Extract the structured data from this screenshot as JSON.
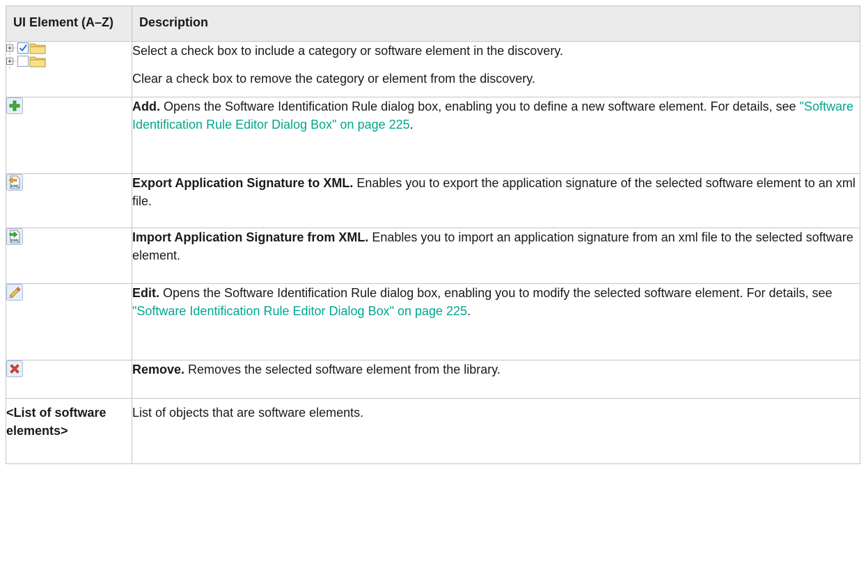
{
  "header": {
    "col1": "UI Element (A–Z)",
    "col2": "Description"
  },
  "rows": {
    "tree": {
      "icon": "tree-checkbox-folder-icons",
      "line1": "Select a check box to include a category or software element in the discovery.",
      "line2": "Clear a check box to remove the category or element from the discovery."
    },
    "add": {
      "icon": "add-icon",
      "title": "Add.",
      "text": " Opens the Software Identification Rule dialog box, enabling you to define a new software element. For details, see ",
      "link": "\"Software Identification Rule Editor Dialog Box\" on page 225",
      "after": "."
    },
    "export": {
      "icon": "export-xml-icon",
      "title": "Export Application Signature to XML.",
      "text": " Enables you to export the application signature of the selected software element to an xml file."
    },
    "import": {
      "icon": "import-xml-icon",
      "title": "Import Application Signature from XML.",
      "text": " Enables you to import an application signature from an xml file to the selected software element."
    },
    "edit": {
      "icon": "edit-pencil-icon",
      "title": "Edit.",
      "text": " Opens the Software Identification Rule dialog box, enabling you to modify the selected software element. For details, see ",
      "link": "\"Software Identification Rule Editor Dialog Box\" on page 225",
      "after": "."
    },
    "remove": {
      "icon": "remove-x-icon",
      "title": "Remove.",
      "text": " Removes the selected software element from the library."
    },
    "list": {
      "element": "<List of software elements>",
      "text": "List of objects that are software elements."
    }
  },
  "colors": {
    "link": "#00a68e",
    "header_bg": "#ebebeb",
    "border": "#c4c4c4"
  }
}
